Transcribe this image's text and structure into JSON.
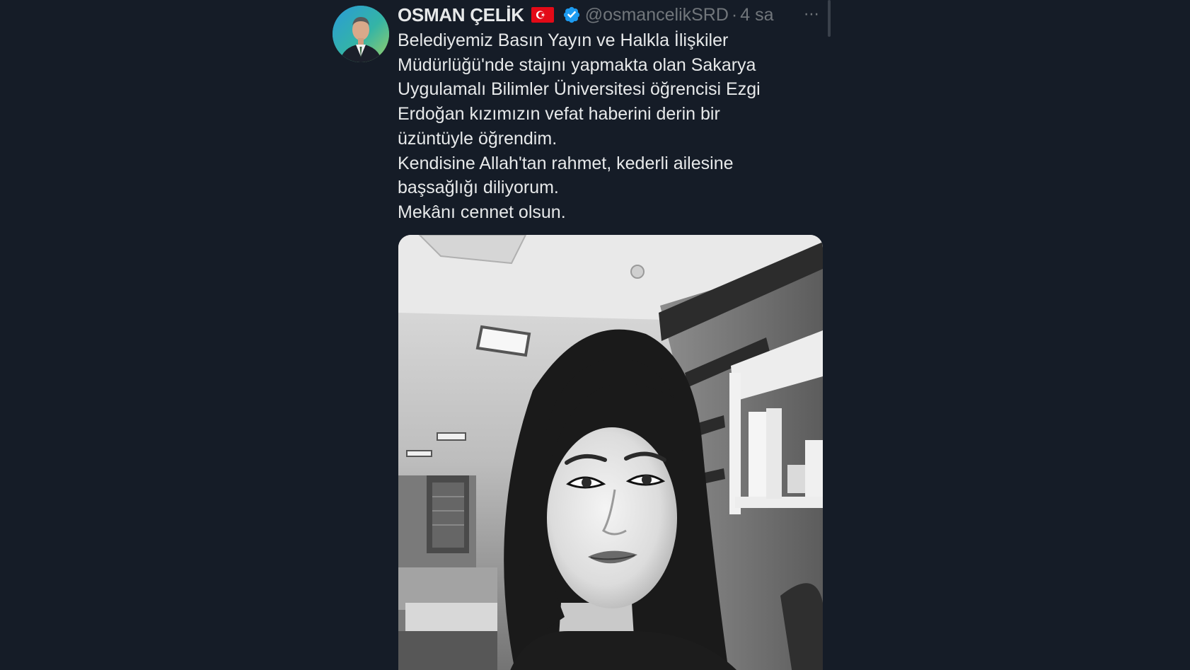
{
  "tweet": {
    "author_name": "OSMAN ÇELİK",
    "flag_icon": "turkey-flag-icon",
    "verified_icon": "verified-badge-icon",
    "handle": "@osmancelikSRD",
    "separator": "·",
    "time": "4 sa",
    "more_icon": "⋯",
    "text_lines": [
      "Belediyemiz Basın Yayın ve Halkla İlişkiler",
      "Müdürlüğü'nde stajını yapmakta olan Sakarya",
      "Uygulamalı Bilimler Üniversitesi öğrencisi Ezgi",
      "Erdoğan kızımızın vefat haberini derin bir",
      "üzüntüyle öğrendim.",
      "Kendisine Allah'tan rahmet, kederli ailesine",
      "başsağlığı diliyorum.",
      "Mekânı cennet olsun."
    ]
  },
  "colors": {
    "background": "#151c27",
    "primary_text": "#e7e9ea",
    "secondary_text": "#71767b",
    "verified_blue": "#1d9bf0",
    "flag_red": "#e30a17"
  }
}
